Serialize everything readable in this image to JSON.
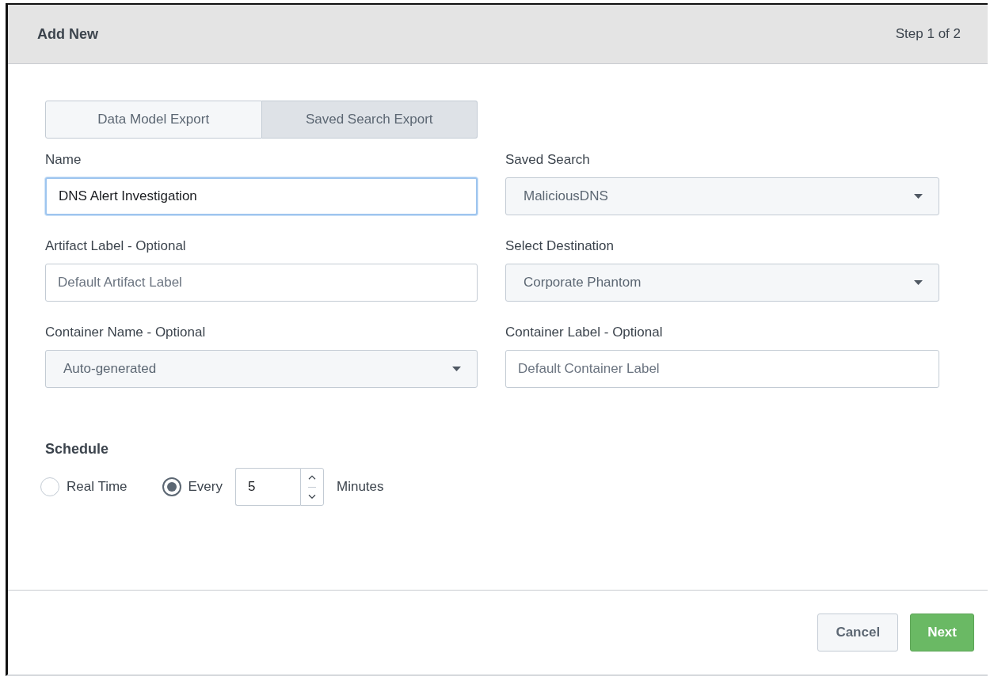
{
  "header": {
    "title": "Add New",
    "step": "Step 1 of 2"
  },
  "tabs": [
    {
      "label": "Data Model Export",
      "selected": false
    },
    {
      "label": "Saved Search Export",
      "selected": true
    }
  ],
  "fields": [
    {
      "label": "Name",
      "kind": "text",
      "value": "DNS Alert Investigation",
      "focused": true
    },
    {
      "label": "Saved Search",
      "kind": "select",
      "value": "MaliciousDNS",
      "focused": false
    },
    {
      "label": "Artifact Label - Optional",
      "kind": "text",
      "placeholder": "Default Artifact Label",
      "focused": false
    },
    {
      "label": "Select Destination",
      "kind": "select",
      "value": "Corporate Phantom",
      "focused": false
    },
    {
      "label": "Container Name - Optional",
      "kind": "select",
      "value": "Auto-generated",
      "focused": false
    },
    {
      "label": "Container Label - Optional",
      "kind": "text",
      "placeholder": "Default Container Label",
      "focused": false
    }
  ],
  "schedule": {
    "title": "Schedule",
    "options": [
      {
        "label": "Real Time",
        "selected": false
      },
      {
        "label": "Every",
        "selected": true
      }
    ],
    "interval": "5",
    "unit": "Minutes"
  },
  "buttons": [
    {
      "label": "Cancel",
      "kind": "secondary"
    },
    {
      "label": "Next",
      "kind": "primary"
    }
  ]
}
